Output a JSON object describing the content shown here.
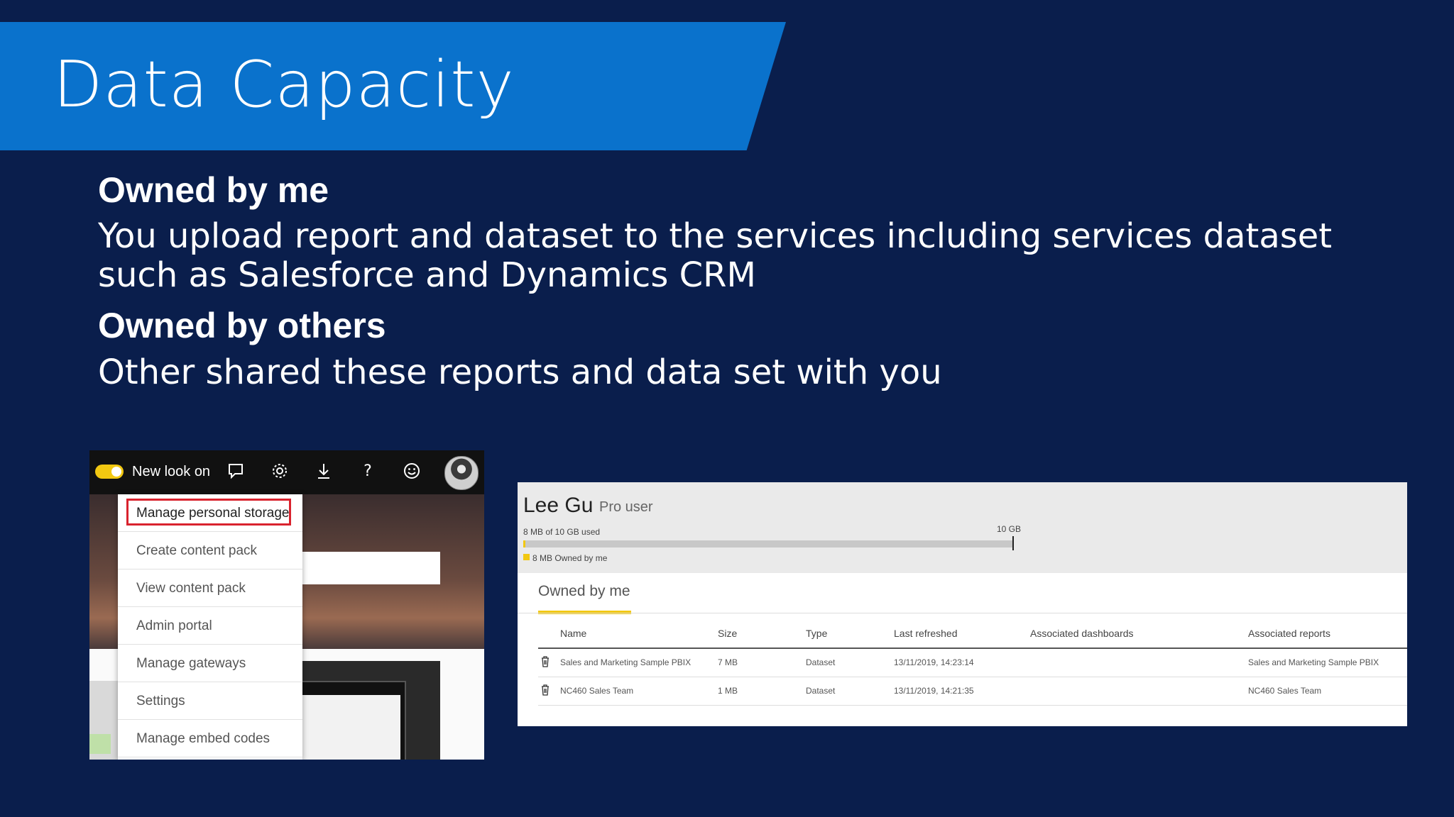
{
  "slide": {
    "title": "Data Capacity",
    "heading_owned_by_me": "Owned by me",
    "text_owned_by_me_line1": "You upload report and dataset to the services including services dataset",
    "text_owned_by_me_line2": "such as Salesforce and Dynamics CRM",
    "heading_owned_by_others": "Owned by others",
    "text_owned_by_others": "Other shared these reports and data set with you"
  },
  "left_screenshot": {
    "toggle_label": "New look on",
    "toolbar_icons": [
      "comment-icon",
      "gear-icon",
      "download-icon",
      "help-icon",
      "smiley-icon",
      "avatar"
    ],
    "menu_items": [
      "Manage personal storage",
      "Create content pack",
      "View content pack",
      "Admin portal",
      "Manage gateways",
      "Settings",
      "Manage embed codes"
    ],
    "highlight_color": "#d9232e"
  },
  "right_screenshot": {
    "user_name": "Lee Gu",
    "user_type": "Pro user",
    "usage_text": "8 MB of 10 GB used",
    "capacity_label": "10 GB",
    "usage_fraction": 0.0008,
    "legend_text": "8 MB Owned by me",
    "tab_label": "Owned by me",
    "accent_color": "#f2c811",
    "columns": [
      "Name",
      "Size",
      "Type",
      "Last refreshed",
      "Associated dashboards",
      "Associated reports"
    ],
    "rows": [
      {
        "name": "Sales and Marketing Sample PBIX",
        "size": "7 MB",
        "type": "Dataset",
        "last_refreshed": "13/11/2019, 14:23:14",
        "dashboards": "",
        "reports": "Sales and Marketing Sample PBIX"
      },
      {
        "name": "NC460 Sales Team",
        "size": "1 MB",
        "type": "Dataset",
        "last_refreshed": "13/11/2019, 14:21:35",
        "dashboards": "",
        "reports": "NC460 Sales Team"
      }
    ]
  },
  "colors": {
    "background": "#0a1e4c",
    "title_banner": "#0a72cc"
  }
}
